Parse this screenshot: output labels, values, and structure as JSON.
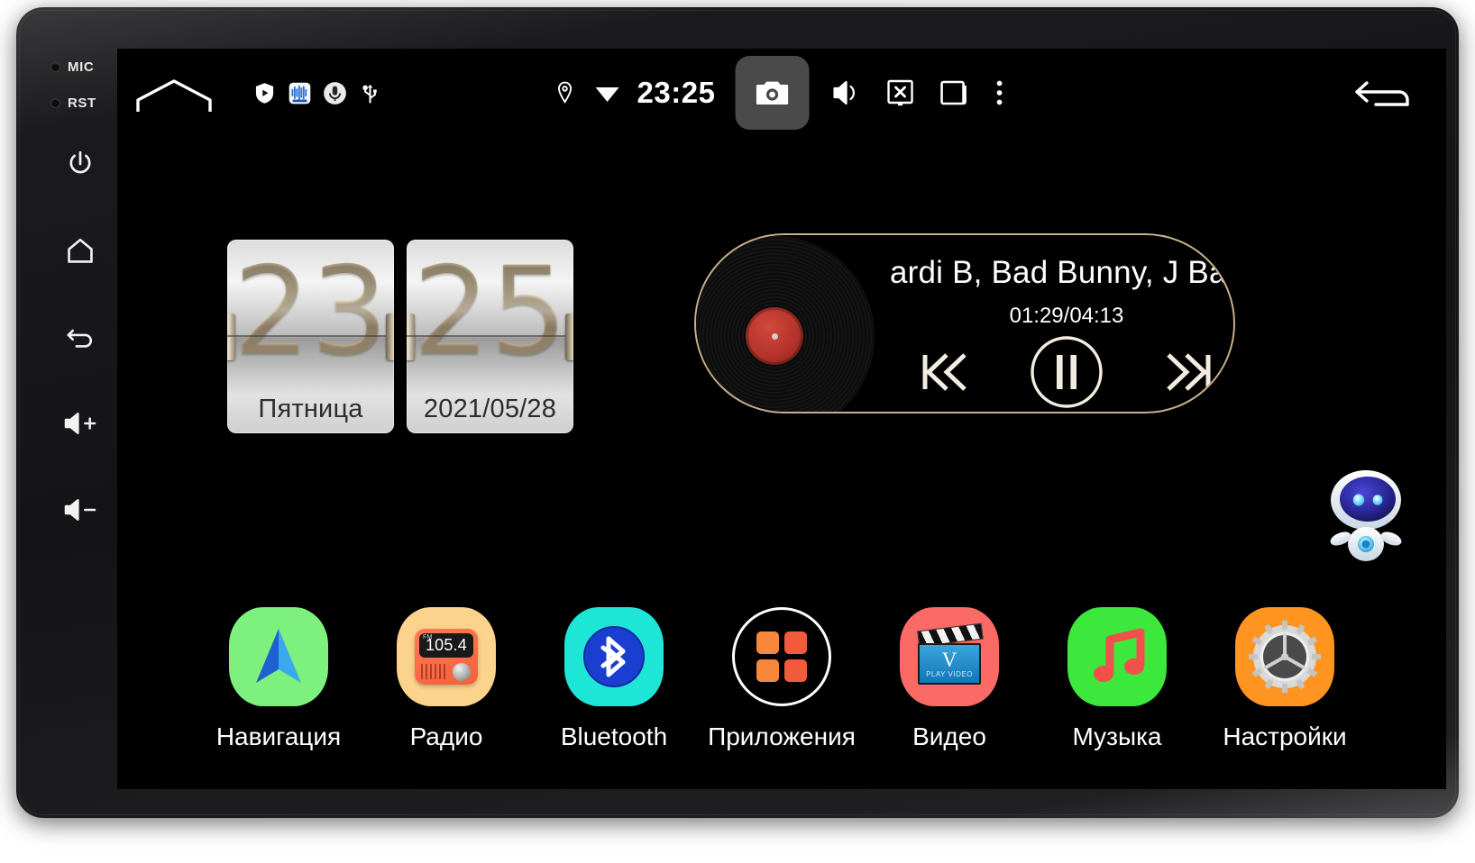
{
  "device": {
    "bezel": {
      "indicators": [
        {
          "label": "MIC",
          "icon": "led-indicator"
        },
        {
          "label": "RST",
          "icon": "led-indicator"
        }
      ],
      "buttons": [
        {
          "name": "power-button",
          "icon": "power-icon"
        },
        {
          "name": "home-button",
          "icon": "home-icon"
        },
        {
          "name": "back-button",
          "icon": "back-arrow-icon"
        },
        {
          "name": "volume-up-button",
          "icon": "volume-up-icon",
          "label": "+"
        },
        {
          "name": "volume-down-button",
          "icon": "volume-down-icon",
          "label": "−"
        }
      ]
    }
  },
  "statusbar": {
    "home_shape_icon": "home-outline-icon",
    "notifications": [
      {
        "name": "shield-play-icon"
      },
      {
        "name": "waveform-app-icon"
      },
      {
        "name": "microphone-icon"
      },
      {
        "name": "usb-icon"
      }
    ],
    "location_icon": "location-pin-icon",
    "wifi_icon": "wifi-icon",
    "clock": "23:25",
    "camera_icon": "camera-icon",
    "volume_icon": "volume-icon",
    "screen_off_icon": "screen-off-icon",
    "recents_icon": "recents-icon",
    "overflow_icon": "more-vertical-icon",
    "back_icon": "back-arrow-icon"
  },
  "clock_widget": {
    "hour": "23",
    "weekday": "Пятница",
    "minute": "25",
    "date": "2021/05/28"
  },
  "player": {
    "vinyl_icon": "vinyl-record-icon",
    "track": "ardi B, Bad Bunny, J Balv",
    "time": "01:29/04:13",
    "prev_icon": "skip-previous-icon",
    "pause_icon": "pause-icon",
    "next_icon": "skip-next-icon",
    "border_color": "#c7b089"
  },
  "assistant": {
    "icon": "robot-assistant-icon",
    "visor_color": "#2c2a9e",
    "eye_color": "#5fd2f5"
  },
  "dock": {
    "apps": [
      {
        "label": "Навигация",
        "icon": "navigation-icon",
        "bg": "#7ef07e"
      },
      {
        "label": "Радио",
        "icon": "radio-icon",
        "bg": "#fbd38d",
        "frequency": "105.4",
        "band": "FM"
      },
      {
        "label": "Bluetooth",
        "icon": "bluetooth-icon",
        "bg": "#1ee6d6"
      },
      {
        "label": "Приложения",
        "icon": "apps-grid-icon",
        "bg": "transparent"
      },
      {
        "label": "Видео",
        "icon": "video-icon",
        "bg": "#fb6a64",
        "clapper_letter": "V",
        "clapper_text": "PLAY VIDEO"
      },
      {
        "label": "Музыка",
        "icon": "music-note-icon",
        "bg": "#3ce83c"
      },
      {
        "label": "Настройки",
        "icon": "settings-gear-icon",
        "bg": "#ff9421"
      }
    ]
  }
}
